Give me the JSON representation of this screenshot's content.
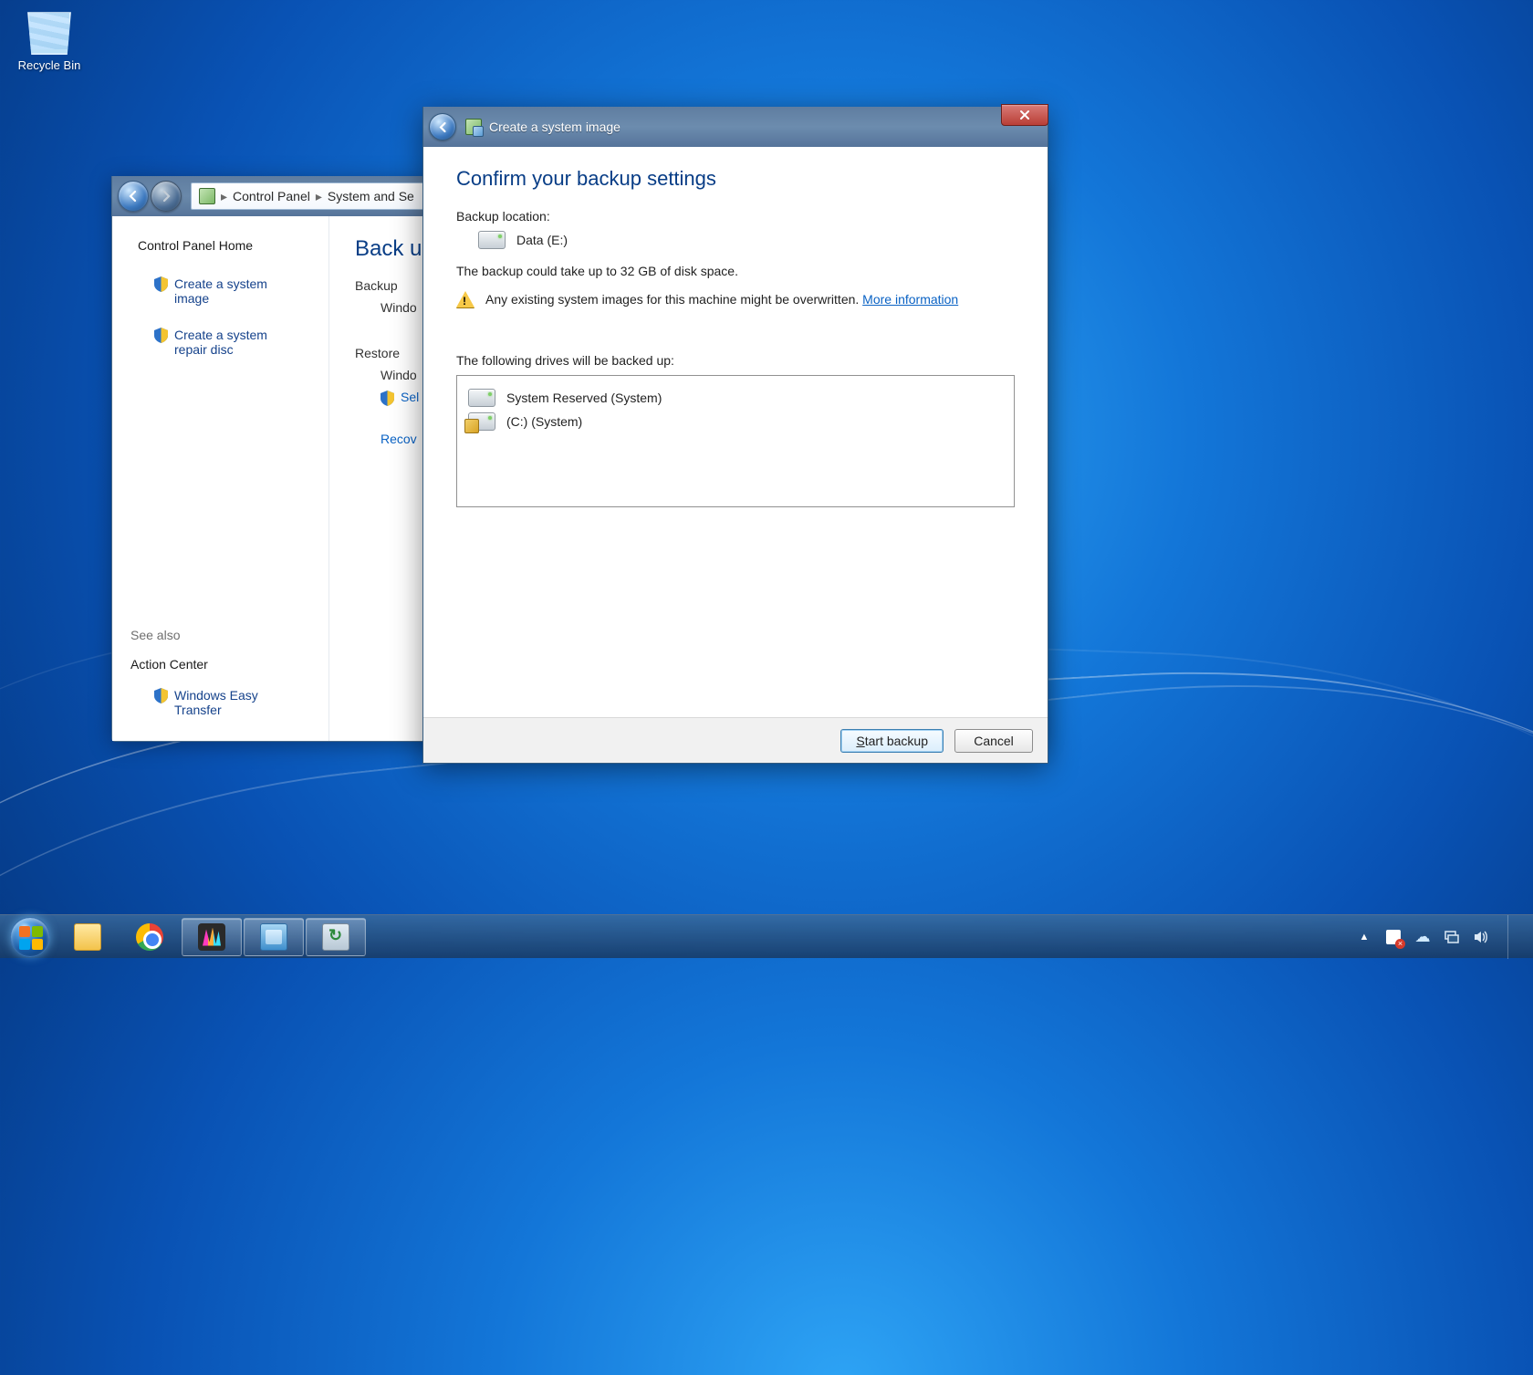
{
  "desktop": {
    "recycle_bin": "Recycle Bin"
  },
  "control_panel": {
    "breadcrumbs": [
      "Control Panel",
      "System and Se"
    ],
    "side": {
      "home": "Control Panel Home",
      "links": {
        "create_image": "Create a system image",
        "create_disc": "Create a system repair disc"
      },
      "see_also_hdr": "See also",
      "see_also": {
        "action_center": "Action Center",
        "easy_transfer": "Windows Easy Transfer"
      }
    },
    "main": {
      "heading": "Back up",
      "backup_label": "Backup",
      "backup_sub": "Windo",
      "restore_label": "Restore",
      "restore_sub": "Windo",
      "select_link": "Sel",
      "recover_link": "Recov"
    }
  },
  "wizard": {
    "title": "Create a system image",
    "heading": "Confirm your backup settings",
    "backup_location_label": "Backup location:",
    "backup_location_value": "Data (E:)",
    "space_notice": "The backup could take up to 32 GB of disk space.",
    "overwrite_warning": "Any existing system images for this machine might be overwritten.",
    "more_info": "More information",
    "drives_label": "The following drives will be backed up:",
    "drives": {
      "d0": "System Reserved (System)",
      "d1": "(C:) (System)"
    },
    "buttons": {
      "start": "Start backup",
      "cancel": "Cancel"
    }
  }
}
